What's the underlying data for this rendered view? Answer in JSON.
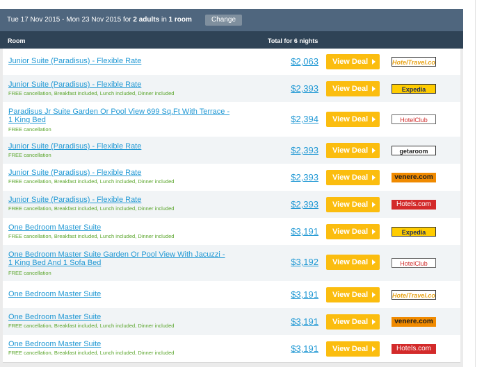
{
  "search": {
    "dates_prefix": "Tue 17 Nov 2015 - Mon 23 Nov 2015 for ",
    "adults": "2 adults",
    "in_text": " in ",
    "rooms": "1 room",
    "change_label": "Change"
  },
  "columns": {
    "room": "Room",
    "total": "Total for 6 nights"
  },
  "deal_label": "View Deal",
  "rows": [
    {
      "name": "Junior Suite (Paradisus) - Flexible Rate",
      "sub": "",
      "price": "$2,063",
      "provider": "HotelTravel.com",
      "logo": "hoteltravel"
    },
    {
      "name": "Junior Suite (Paradisus) - Flexible Rate",
      "sub": "FREE cancellation, Breakfast included, Lunch included, Dinner included",
      "price": "$2,393",
      "provider": "Expedia",
      "logo": "expedia"
    },
    {
      "name": "Paradisus Jr Suite Garden Or Pool View 699 Sq.Ft With Terrace - 1 King Bed",
      "sub": "FREE cancellation",
      "price": "$2,394",
      "provider": "HotelClub",
      "logo": "hotelclub"
    },
    {
      "name": "Junior Suite (Paradisus) - Flexible Rate",
      "sub": "FREE cancellation",
      "price": "$2,393",
      "provider": "getaroom",
      "logo": "getaroom"
    },
    {
      "name": "Junior Suite (Paradisus) - Flexible Rate",
      "sub": "FREE cancellation, Breakfast included, Lunch included, Dinner included",
      "price": "$2,393",
      "provider": "venere.com",
      "logo": "venere"
    },
    {
      "name": "Junior Suite (Paradisus) - Flexible Rate",
      "sub": "FREE cancellation, Breakfast included, Lunch included, Dinner included",
      "price": "$2,393",
      "provider": "Hotels.com",
      "logo": "hotels"
    },
    {
      "name": "One Bedroom Master Suite",
      "sub": "FREE cancellation, Breakfast included, Lunch included, Dinner included",
      "price": "$3,191",
      "provider": "Expedia",
      "logo": "expedia"
    },
    {
      "name": "One Bedroom Master Suite Garden Or Pool View With Jacuzzi - 1 King Bed And 1 Sofa Bed",
      "sub": "FREE cancellation",
      "price": "$3,192",
      "provider": "HotelClub",
      "logo": "hotelclub"
    },
    {
      "name": "One Bedroom Master Suite",
      "sub": "",
      "price": "$3,191",
      "provider": "HotelTravel.com",
      "logo": "hoteltravel"
    },
    {
      "name": "One Bedroom Master Suite",
      "sub": "FREE cancellation, Breakfast included, Lunch included, Dinner included",
      "price": "$3,191",
      "provider": "venere.com",
      "logo": "venere"
    },
    {
      "name": "One Bedroom Master Suite",
      "sub": "FREE cancellation, Breakfast included, Lunch included, Dinner included",
      "price": "$3,191",
      "provider": "Hotels.com",
      "logo": "hotels"
    }
  ]
}
